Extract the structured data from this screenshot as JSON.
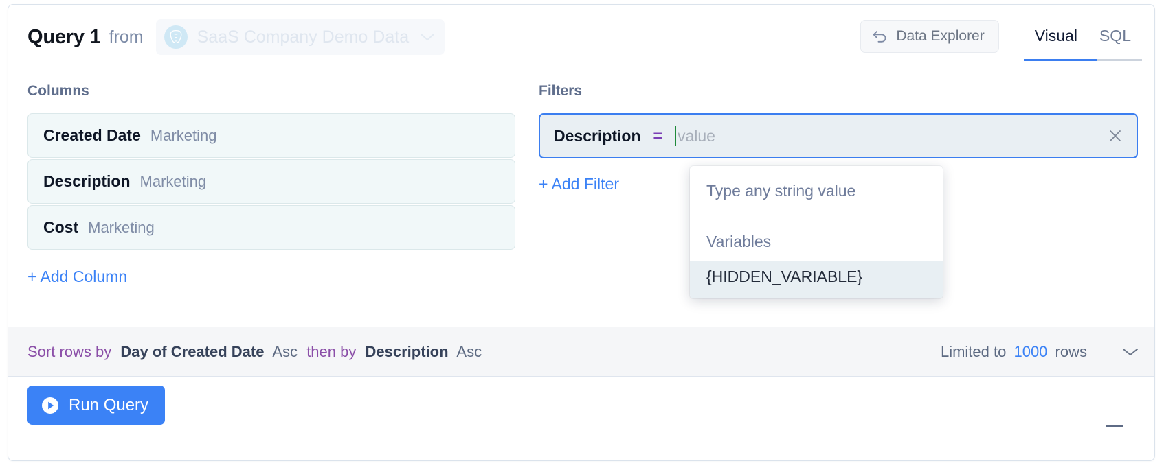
{
  "header": {
    "query_title": "Query 1",
    "from_label": "from",
    "datasource_name": "SaaS Company Demo Data",
    "datasource_icon": "postgres-elephant-icon",
    "datasource_caret_icon": "chevron-down-icon",
    "data_explorer_label": "Data Explorer",
    "data_explorer_icon": "back-arrow-icon",
    "tabs": [
      {
        "label": "Visual",
        "active": true
      },
      {
        "label": "SQL",
        "active": false
      }
    ]
  },
  "columns": {
    "section_label": "Columns",
    "items": [
      {
        "name": "Created Date",
        "source": "Marketing"
      },
      {
        "name": "Description",
        "source": "Marketing"
      },
      {
        "name": "Cost",
        "source": "Marketing"
      }
    ],
    "add_label": "+ Add Column"
  },
  "filters": {
    "section_label": "Filters",
    "chip": {
      "field": "Description",
      "operator": "=",
      "value": "",
      "placeholder": "value",
      "close_icon": "close-icon"
    },
    "add_label": "+ Add Filter"
  },
  "dropdown": {
    "hint": "Type any string value",
    "group_label": "Variables",
    "options": [
      {
        "label": "{HIDDEN_VARIABLE}",
        "highlighted": true
      }
    ]
  },
  "sort_bar": {
    "prefix": "Sort rows by",
    "first_field": "Day of Created Date",
    "first_direction": "Asc",
    "conjunction": "then by",
    "second_field": "Description",
    "second_direction": "Asc",
    "limit_prefix": "Limited to",
    "limit_value": "1000",
    "limit_suffix": "rows",
    "limit_caret_icon": "chevron-down-icon"
  },
  "run_bar": {
    "run_label": "Run Query",
    "run_icon": "play-circle-icon",
    "collapse_icon": "minus-icon"
  },
  "colors": {
    "accent_blue": "#3b82f6",
    "focus_blue": "#3b7ef0",
    "operator_purple": "#7b3fb5",
    "sort_purple": "#8b4fa8",
    "chip_bg": "#f1f8f9",
    "caret_green": "#1f8a3a"
  }
}
